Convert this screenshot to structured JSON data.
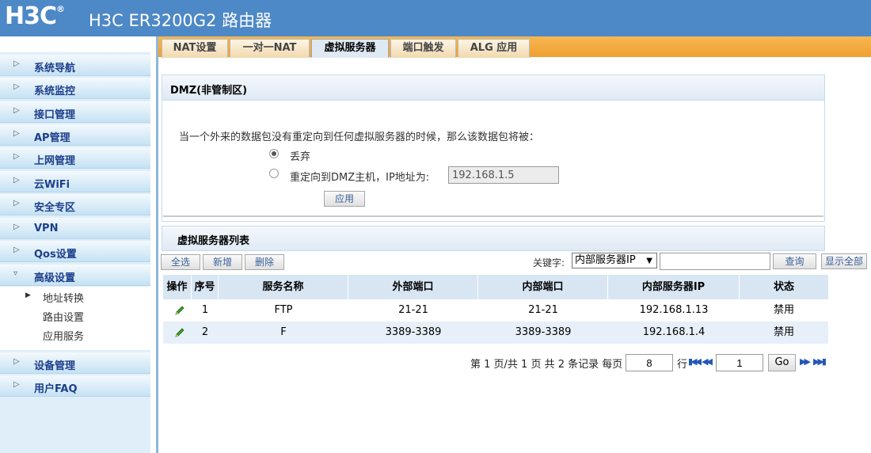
{
  "header": {
    "logo": "H3C",
    "logo_mark": "®",
    "title": "H3C ER3200G2 路由器"
  },
  "sidebar": {
    "items": [
      {
        "label": "系统导航"
      },
      {
        "label": "系统监控"
      },
      {
        "label": "接口管理"
      },
      {
        "label": "AP管理"
      },
      {
        "label": "上网管理"
      },
      {
        "label": "云WiFi"
      },
      {
        "label": "安全专区"
      },
      {
        "label": "VPN"
      },
      {
        "label": "Qos设置"
      },
      {
        "label": "高级设置"
      },
      {
        "label": "设备管理"
      },
      {
        "label": "用户FAQ"
      }
    ],
    "sub_items": [
      {
        "label": "地址转换"
      },
      {
        "label": "路由设置"
      },
      {
        "label": "应用服务"
      }
    ]
  },
  "tabs": [
    {
      "label": "NAT设置"
    },
    {
      "label": "一对一NAT"
    },
    {
      "label": "虚拟服务器"
    },
    {
      "label": "端口触发"
    },
    {
      "label": "ALG 应用"
    }
  ],
  "dmz": {
    "title": "DMZ(非管制区)",
    "description": "当一个外来的数据包没有重定向到任何虚拟服务器的时候，那么该数据包将被：",
    "option_discard": "丢弃",
    "option_redirect": "重定向到DMZ主机，IP地址为:",
    "ip_value": "192.168.1.5",
    "apply_label": "应用"
  },
  "vs_list": {
    "title": "虚拟服务器列表",
    "btn_select_all": "全选",
    "btn_add": "新增",
    "btn_delete": "删除",
    "keyword_label": "关键字:",
    "keyword_select": "内部服务器IP",
    "btn_search": "查询",
    "btn_show_all": "显示全部",
    "columns": [
      "操作",
      "序号",
      "服务名称",
      "外部端口",
      "内部端口",
      "内部服务器IP",
      "状态"
    ],
    "rows": [
      {
        "index": "1",
        "name": "FTP",
        "ext_port": "21-21",
        "int_port": "21-21",
        "ip": "192.168.1.13",
        "status": "禁用"
      },
      {
        "index": "2",
        "name": "F",
        "ext_port": "3389-3389",
        "int_port": "3389-3389",
        "ip": "192.168.1.4",
        "status": "禁用"
      }
    ]
  },
  "pagination": {
    "summary": "第 1 页/共 1 页 共 2 条记录 每页",
    "per_page": "8",
    "rows_label": "行",
    "page_input": "1",
    "go_label": "Go"
  }
}
